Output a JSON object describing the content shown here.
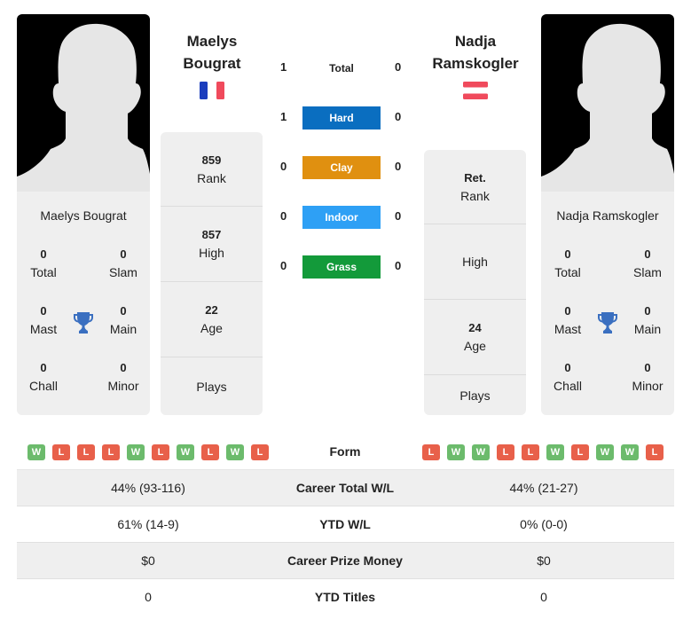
{
  "players": {
    "left": {
      "name_line1": "Maelys",
      "name_line2": "Bougrat",
      "full_name": "Maelys Bougrat",
      "flag": "france-flag",
      "flag_colors": [
        "#1b3dbd",
        "#ffffff",
        "#f04a5c"
      ],
      "titles": {
        "total": {
          "value": "0",
          "label": "Total"
        },
        "slam": {
          "value": "0",
          "label": "Slam"
        },
        "mast": {
          "value": "0",
          "label": "Mast"
        },
        "main": {
          "value": "0",
          "label": "Main"
        },
        "chall": {
          "value": "0",
          "label": "Chall"
        },
        "minor": {
          "value": "0",
          "label": "Minor"
        }
      },
      "stats": {
        "rank": {
          "value": "859",
          "label": "Rank"
        },
        "high": {
          "value": "857",
          "label": "High"
        },
        "age": {
          "value": "22",
          "label": "Age"
        },
        "plays": {
          "value": "",
          "label": "Plays"
        }
      },
      "form": [
        "W",
        "L",
        "L",
        "L",
        "W",
        "L",
        "W",
        "L",
        "W",
        "L"
      ]
    },
    "right": {
      "name_line1": "Nadja",
      "name_line2": "Ramskogler",
      "full_name": "Nadja Ramskogler",
      "flag": "austria-flag",
      "flag_colors": [
        "#f04a5c",
        "#ffffff",
        "#f04a5c"
      ],
      "titles": {
        "total": {
          "value": "0",
          "label": "Total"
        },
        "slam": {
          "value": "0",
          "label": "Slam"
        },
        "mast": {
          "value": "0",
          "label": "Mast"
        },
        "main": {
          "value": "0",
          "label": "Main"
        },
        "chall": {
          "value": "0",
          "label": "Chall"
        },
        "minor": {
          "value": "0",
          "label": "Minor"
        }
      },
      "stats": {
        "rank": {
          "value": "Ret.",
          "label": "Rank"
        },
        "high": {
          "value": "",
          "label": "High"
        },
        "age": {
          "value": "24",
          "label": "Age"
        },
        "plays": {
          "value": "",
          "label": "Plays"
        }
      },
      "form": [
        "L",
        "W",
        "W",
        "L",
        "L",
        "W",
        "L",
        "W",
        "W",
        "L"
      ]
    }
  },
  "h2h": [
    {
      "label": "Total",
      "left": "1",
      "right": "0",
      "color": ""
    },
    {
      "label": "Hard",
      "left": "1",
      "right": "0",
      "color": "#0a6ec0"
    },
    {
      "label": "Clay",
      "left": "0",
      "right": "0",
      "color": "#e09010"
    },
    {
      "label": "Indoor",
      "left": "0",
      "right": "0",
      "color": "#2ea0f5"
    },
    {
      "label": "Grass",
      "left": "0",
      "right": "0",
      "color": "#139a3a"
    }
  ],
  "form_label": "Form",
  "comparison": [
    {
      "label": "Career Total W/L",
      "left": "44% (93-116)",
      "right": "44% (21-27)"
    },
    {
      "label": "YTD W/L",
      "left": "61% (14-9)",
      "right": "0% (0-0)"
    },
    {
      "label": "Career Prize Money",
      "left": "$0",
      "right": "$0"
    },
    {
      "label": "YTD Titles",
      "left": "0",
      "right": "0"
    }
  ],
  "colors": {
    "win": "#6cbb6c",
    "loss": "#e8604a",
    "trophy": "#3a6fc0",
    "card_bg": "#efefef"
  }
}
